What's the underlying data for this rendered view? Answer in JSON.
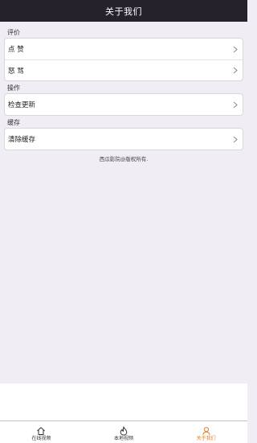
{
  "header": {
    "title": "关于我们"
  },
  "sections": [
    {
      "label": "评价",
      "items": [
        {
          "label": "点 赞"
        },
        {
          "label": "怒 骂"
        }
      ]
    },
    {
      "label": "操作",
      "items": [
        {
          "label": "检查更新"
        }
      ]
    },
    {
      "label": "缓存",
      "items": [
        {
          "label": "清除缓存"
        }
      ]
    }
  ],
  "footer": {
    "copyright": "西瓜影院@版权所有."
  },
  "tabbar": {
    "tabs": [
      {
        "label": "在线视频",
        "icon": "home-icon"
      },
      {
        "label": "本地视频",
        "icon": "flame-icon"
      },
      {
        "label": "关于我们",
        "icon": "person-icon",
        "active": true
      }
    ],
    "accent_color": "#e0802a"
  }
}
